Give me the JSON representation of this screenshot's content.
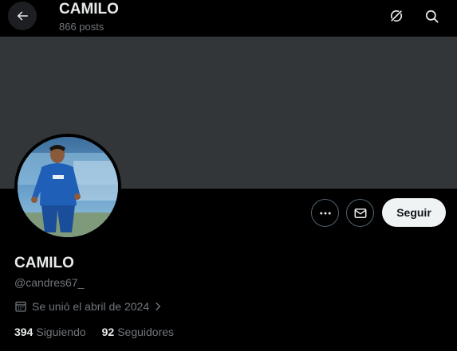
{
  "header": {
    "title": "CAMILO",
    "posts": "866 posts",
    "back_icon": "arrow-left-icon",
    "grok_icon": "grok-icon",
    "search_icon": "search-icon"
  },
  "banner": {
    "color": "#333639"
  },
  "profile": {
    "name": "CAMILO",
    "handle": "@candres67_",
    "joined": "Se unió el abril de 2024",
    "following_count": "394",
    "following_label": "Siguiendo",
    "followers_count": "92",
    "followers_label": "Seguidores"
  },
  "actions": {
    "more_icon": "more-icon",
    "message_icon": "envelope-icon",
    "follow_label": "Seguir"
  },
  "colors": {
    "background": "#000000",
    "text_primary": "#e7e9ea",
    "text_secondary": "#71767b",
    "button_bg": "#eff3f4",
    "border": "#536471"
  }
}
